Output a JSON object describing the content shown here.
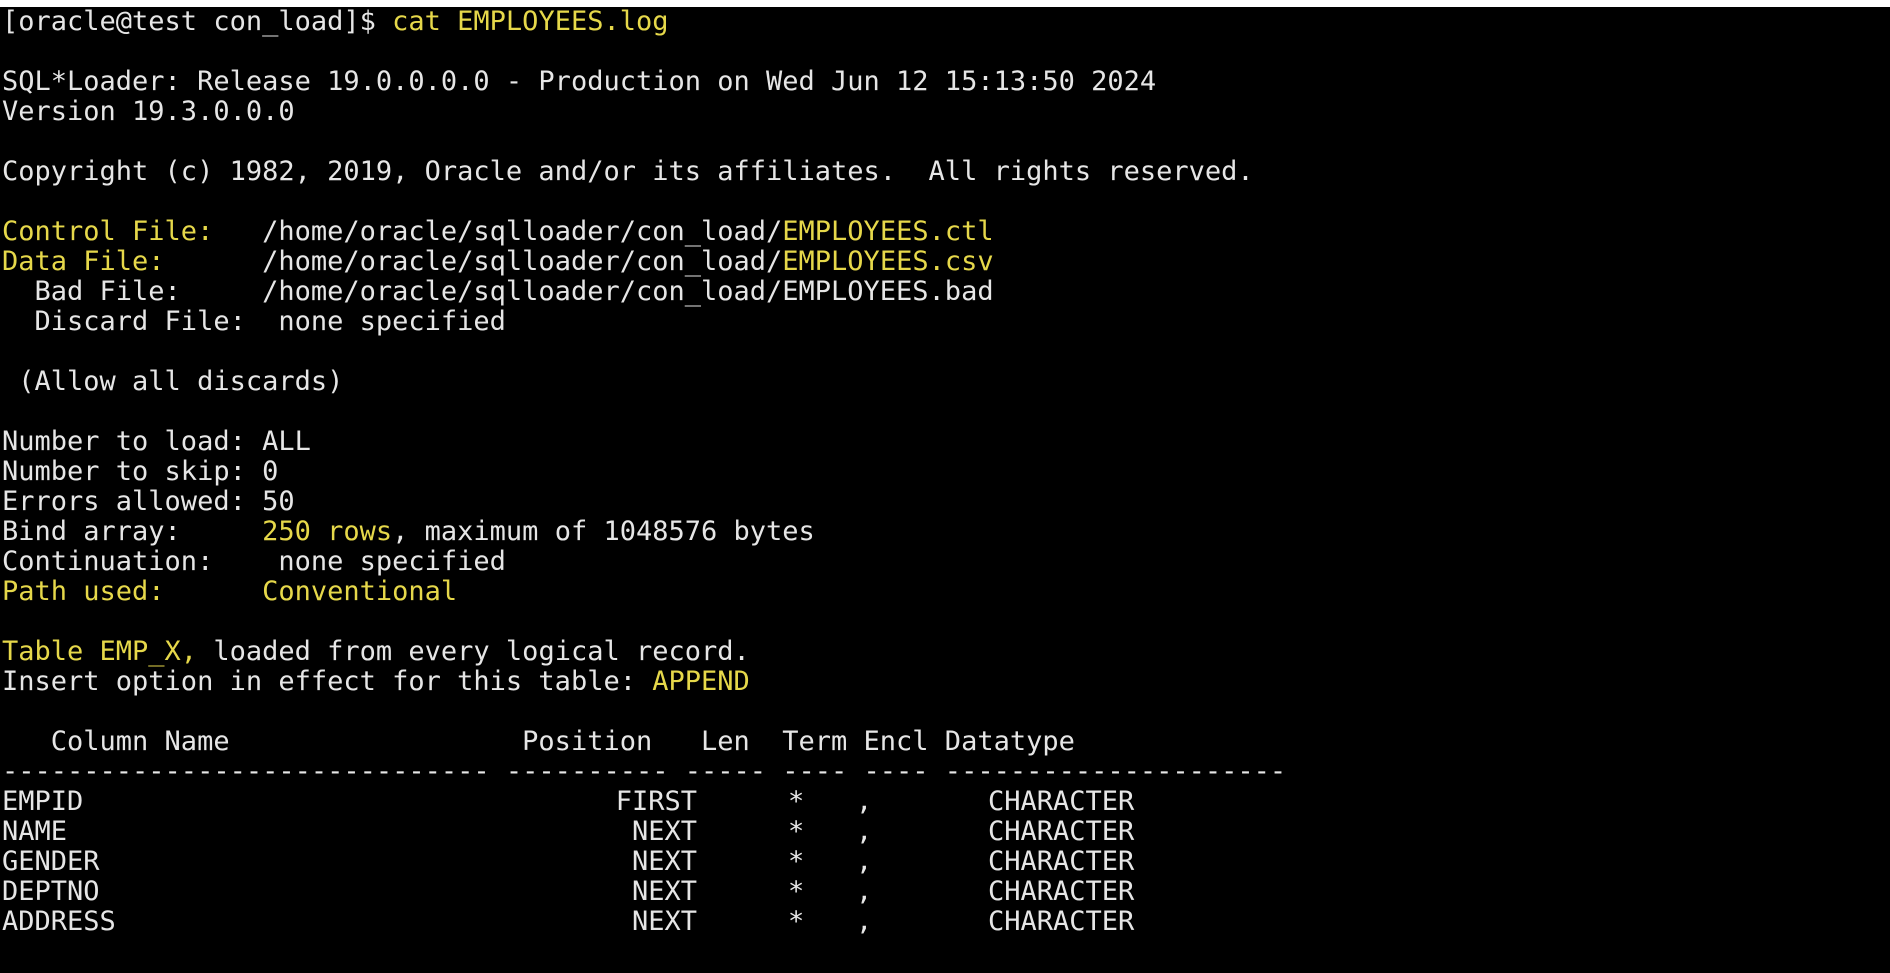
{
  "colors": {
    "background": "#000000",
    "text": "#e6e6e6",
    "highlight": "#e6d84a"
  },
  "prompt": {
    "text": "[oracle@test con_load]$ ",
    "command": "cat EMPLOYEES.log"
  },
  "banner": {
    "release": "SQL*Loader: Release 19.0.0.0.0 - Production on Wed Jun 12 15:13:50 2024",
    "version": "Version 19.3.0.0.0",
    "copyright": "Copyright (c) 1982, 2019, Oracle and/or its affiliates.  All rights reserved."
  },
  "files": {
    "control_label": "Control File:",
    "control_path": "   /home/oracle/sqlloader/con_load/",
    "control_name": "EMPLOYEES.ctl",
    "data_label": "Data File:",
    "data_path": "      /home/oracle/sqlloader/con_load/",
    "data_name": "EMPLOYEES.csv",
    "bad": "  Bad File:     /home/oracle/sqlloader/con_load/EMPLOYEES.bad",
    "discard": "  Discard File:  none specified",
    "allow": " (Allow all discards)"
  },
  "settings": {
    "load": "Number to load: ALL",
    "skip": "Number to skip: 0",
    "errors": "Errors allowed: 50",
    "bind_label": "Bind array:     ",
    "bind_rows": "250 rows",
    "bind_rest": ", maximum of 1048576 bytes",
    "continuation": "Continuation:    none specified",
    "path_label": "Path used:      ",
    "path_value": "Conventional"
  },
  "table": {
    "name": "Table EMP_X,",
    "loaded": " loaded from every logical record.",
    "insert_label": "Insert option in effect for this table: ",
    "insert_value": "APPEND"
  },
  "columns": {
    "header": "   Column Name                  Position   Len  Term Encl Datatype",
    "rule": "------------------------------ ---------- ----- ---- ---- ---------------------",
    "rows": [
      {
        "name": "EMPID",
        "position": "FIRST",
        "len": "*",
        "term": ",",
        "type": "CHARACTER"
      },
      {
        "name": "NAME",
        "position": "NEXT",
        "len": "*",
        "term": ",",
        "type": "CHARACTER"
      },
      {
        "name": "GENDER",
        "position": "NEXT",
        "len": "*",
        "term": ",",
        "type": "CHARACTER"
      },
      {
        "name": "DEPTNO",
        "position": "NEXT",
        "len": "*",
        "term": ",",
        "type": "CHARACTER"
      },
      {
        "name": "ADDRESS",
        "position": "NEXT",
        "len": "*",
        "term": ",",
        "type": "CHARACTER"
      }
    ]
  }
}
